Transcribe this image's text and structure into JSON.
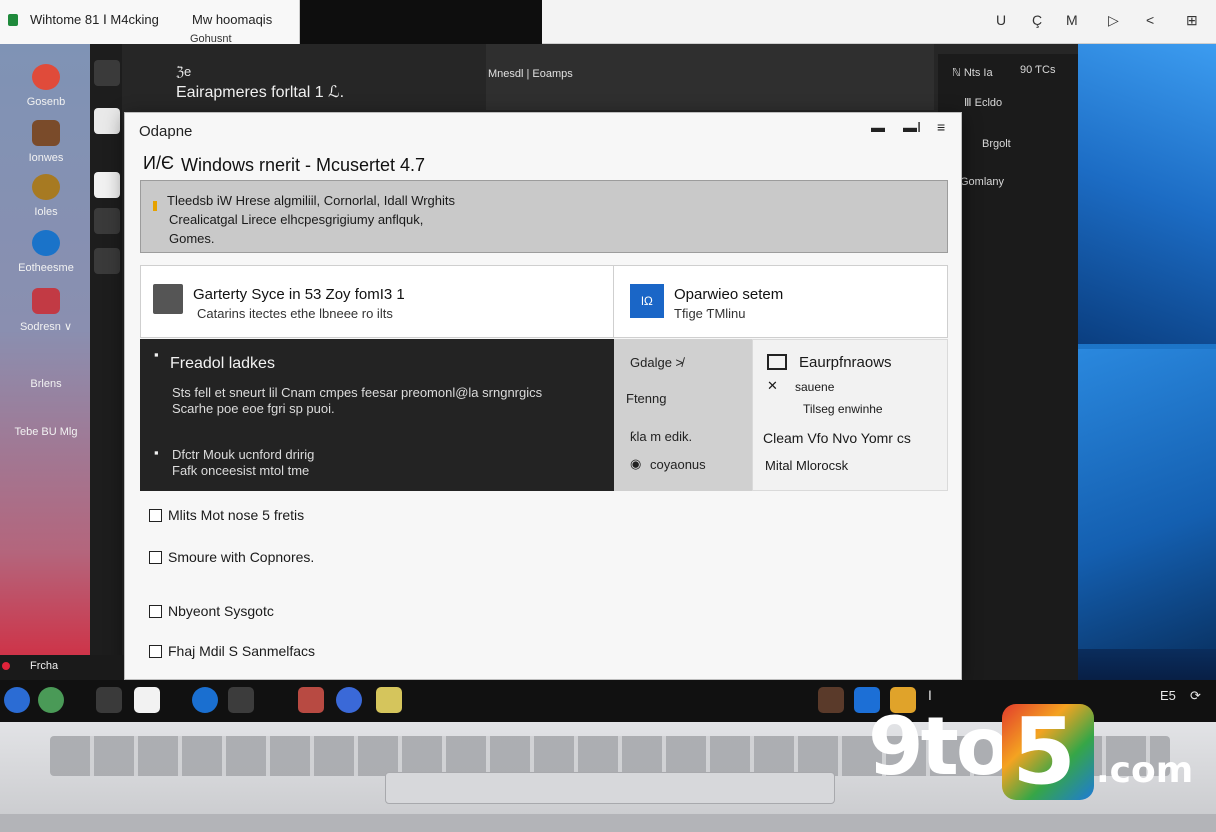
{
  "topbar": {
    "app_title": "Wihtome 81 Ⅰ M4cking",
    "tab2_title": "Mw hoomaqis",
    "tab2_sub": "Gohusnt",
    "controls": [
      "U",
      "Ç",
      "M",
      "▷",
      "<",
      "⊞"
    ]
  },
  "desktop": {
    "icons": [
      {
        "label": "Gosenb",
        "icon": "chrome-icon",
        "color": "#e04b3a"
      },
      {
        "label": "Ionwes",
        "icon": "toolbox-icon",
        "color": "#7a4b2a"
      },
      {
        "label": "Ioles",
        "icon": "shield-icon",
        "color": "#a77a22"
      },
      {
        "label": "Eotheesme",
        "icon": "edge-icon",
        "color": "#1a73c9"
      },
      {
        "label": "Sodresn ∨",
        "icon": "app-icon",
        "color": "#c23a44"
      },
      {
        "label": "Brlens",
        "icon": "",
        "color": ""
      },
      {
        "label": "Tebe BU Mlg",
        "icon": "",
        "color": ""
      }
    ]
  },
  "background_window": {
    "line1": "ℨe",
    "line2": "Eairapmeres forltal 1 ℒ.",
    "panel_title": "Mnesdl | Eoamps",
    "right_items": [
      "ℕ Nts Ia",
      "90 ƬCs",
      "Ⅲ Ecldo",
      "Brgolt",
      "Gomlany"
    ]
  },
  "dialog": {
    "title": "Odapne",
    "heading": "Windows rnerit - Mcusertet 4.7",
    "heading_glyph": "И/Є",
    "controls": [
      "▬",
      "▬Ⅰ",
      "≡"
    ],
    "banner_lines": [
      "Tleedsb iW Hrese algmiliil, Cornorlal, Idall Wrghits",
      "Crealicatgal Lirece elhcpesgrigiumy anflquk,",
      "Gomes."
    ],
    "card1": {
      "title": "Garterty Syce in 53 Zoy fomI3 1",
      "subtitle": "Catarins itectes ethe lbneee ro ilts"
    },
    "card2": {
      "icon_text": "lΩ",
      "title": "Oparwieo setem",
      "subtitle": "Tfige ƬMlinu"
    },
    "dark_panel": {
      "heading": "Freadol ladkes",
      "body_lines": [
        "Sts fell et sneurt lil Cnam cmpes feesar preomonl@la srngnrgics",
        "Scarhe poe eoe fgri sp puoi."
      ],
      "footer_lines": [
        "Dfctr Mouk ucnford dririg",
        "Fafk onceesist mtol tme"
      ]
    },
    "mid_panel": [
      "Gdalge ≯",
      "Ftenng",
      "ƙla m edik.",
      "coyaonus"
    ],
    "right_panel": {
      "title": "Eaurpfnraows",
      "items": [
        "sauene",
        "Tilseg enwinhe",
        "Cleam Vfo Nvo Yomr cs",
        "Mital Mlorocsk"
      ]
    },
    "checklist": [
      "Mlits Mot nose 5 fretis",
      "Smoure with Copnores.",
      "Nbyeont Sysgotc",
      "Fhaj Mdil S Sanmelfacs"
    ]
  },
  "taskbar": {
    "left_label": "Frcha",
    "tray_text": [
      "Ⅰ",
      "E5"
    ],
    "pinned": [
      {
        "icon": "start-icon",
        "color": "#2b6cd4"
      },
      {
        "icon": "files-icon",
        "color": "#4a9a57"
      },
      {
        "icon": "cart-icon",
        "color": "#3a3a3a"
      },
      {
        "icon": "doc-icon",
        "color": "#f2f2f2"
      },
      {
        "icon": "mail-icon",
        "color": "#1a6fd0"
      },
      {
        "icon": "store-icon",
        "color": "#3c3c3c"
      },
      {
        "icon": "game-icon",
        "color": "#b84a42"
      },
      {
        "icon": "browser-icon",
        "color": "#3a69d8"
      },
      {
        "icon": "photos-icon",
        "color": "#d5c55c"
      }
    ]
  },
  "watermark": {
    "brand_a": "9to",
    "brand_b": "5",
    "brand_c": ".com"
  }
}
